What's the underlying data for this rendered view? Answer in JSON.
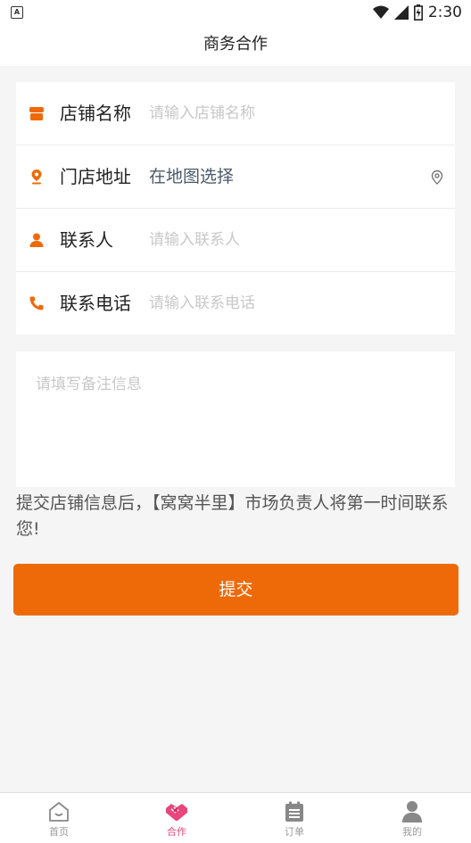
{
  "status": {
    "badge": "A",
    "time": "2:30"
  },
  "header": {
    "title": "商务合作"
  },
  "form": {
    "rows": [
      {
        "label": "店铺名称",
        "placeholder": "请输入店铺名称",
        "icon": "store-icon"
      },
      {
        "label": "门店地址",
        "value": "在地图选择",
        "icon": "location-icon"
      },
      {
        "label": "联系人",
        "placeholder": "请输入联系人",
        "icon": "person-icon"
      },
      {
        "label": "联系电话",
        "placeholder": "请输入联系电话",
        "icon": "phone-icon"
      }
    ],
    "remark_placeholder": "请填写备注信息"
  },
  "notice": "提交店铺信息后，【窝窝半里】市场负责人将第一时间联系您!",
  "submit_label": "提交",
  "tabs": [
    {
      "label": "首页",
      "icon": "home-icon"
    },
    {
      "label": "合作",
      "icon": "handshake-icon",
      "active": true
    },
    {
      "label": "订单",
      "icon": "clipboard-icon"
    },
    {
      "label": "我的",
      "icon": "user-icon"
    }
  ],
  "colors": {
    "accent": "#ee6a08",
    "tab_active": "#e8467c",
    "background": "#f5f5f5"
  }
}
